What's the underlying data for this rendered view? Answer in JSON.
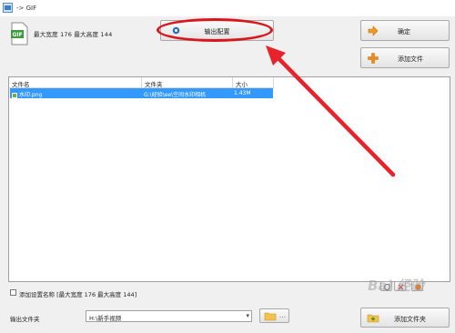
{
  "window": {
    "title": "-> GIF"
  },
  "format": {
    "max_dims": "最大宽度 176 最大高度 144"
  },
  "buttons": {
    "output_settings": "输出配置",
    "confirm": "确定",
    "add_file": "添加文件",
    "add_folder": "添加文件夹"
  },
  "file_list": {
    "columns": [
      "文件名",
      "文件夹",
      "大小"
    ],
    "rows": [
      {
        "name": "水印.png",
        "folder": "G:\\经验\\ee\\空间水印相机",
        "size": "1.43M"
      }
    ]
  },
  "options": {
    "add_settings_name_label": "添加设置名称 [最大宽度 176 最大高度 144]"
  },
  "output": {
    "folder_label": "输出文件夹",
    "folder_value": "H:\\新手视频"
  },
  "watermark": "Bai 经验",
  "colors": {
    "selection": "#3399ff",
    "annotation": "#d9161b"
  }
}
